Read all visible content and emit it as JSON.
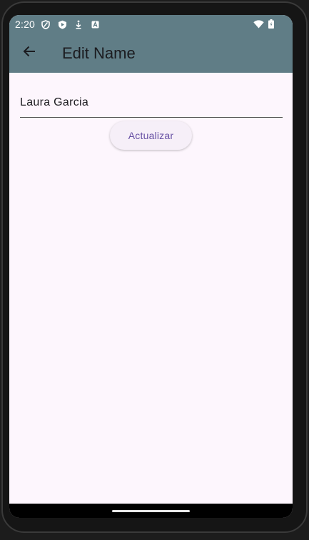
{
  "status_bar": {
    "time": "2:20",
    "icons_left": [
      "shield-icon",
      "play-protect-icon",
      "download-icon",
      "text-a-icon"
    ],
    "icons_right": [
      "wifi-icon",
      "battery-icon"
    ]
  },
  "app_bar": {
    "title": "Edit Name",
    "back_icon": "arrow-back-icon",
    "background": "#607d86"
  },
  "form": {
    "name_value": "Laura Garcia",
    "update_label": "Actualizar",
    "accent": "#6750a4"
  },
  "theme": {
    "surface": "#fdf6fd"
  }
}
